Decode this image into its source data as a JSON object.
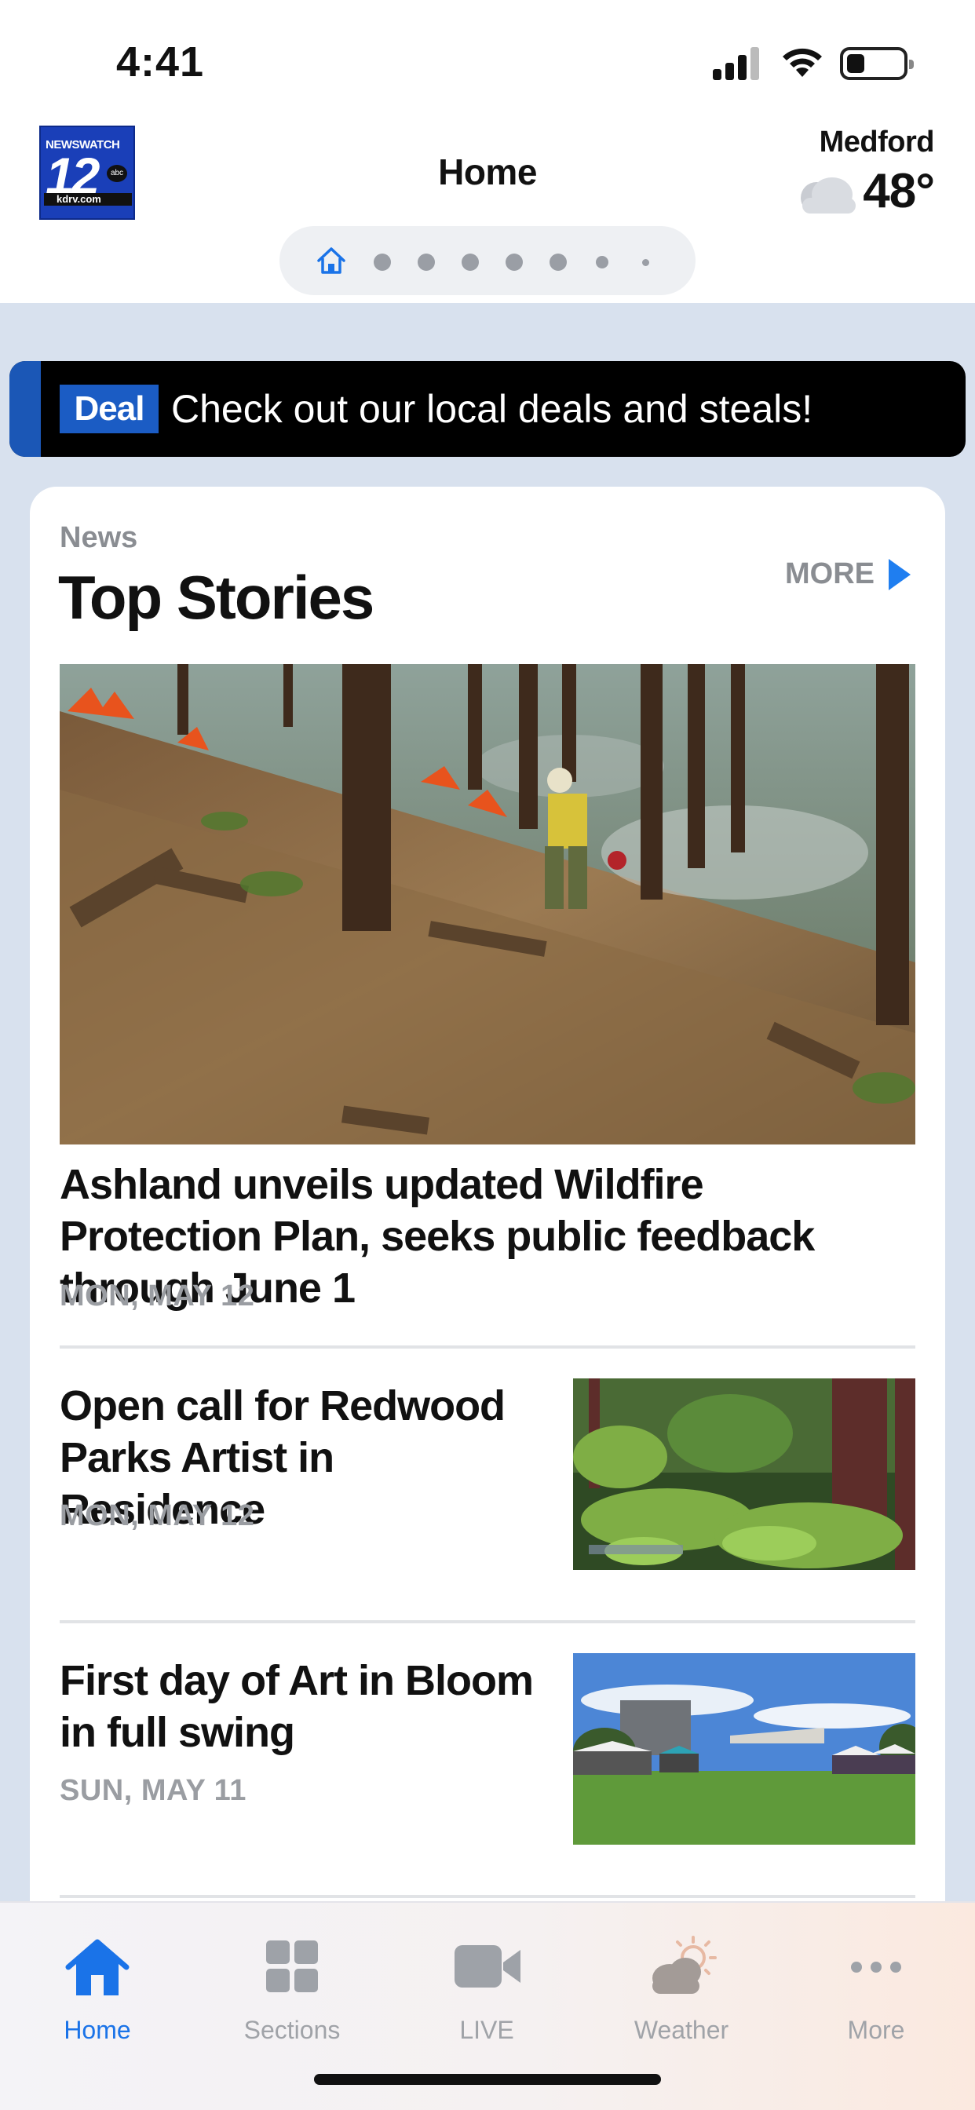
{
  "status_bar": {
    "time": "4:41"
  },
  "header": {
    "logo": {
      "brand": "NEWSWATCH",
      "number": "12",
      "network": "abc",
      "url": "kdrv.com"
    },
    "title": "Home",
    "weather": {
      "city": "Medford",
      "temperature": "48°",
      "icon": "partly-cloudy-icon"
    },
    "pager": {
      "current_index": 0,
      "dot_count": 7
    }
  },
  "deal_banner": {
    "badge": "Deal",
    "message": "Check out our local deals and steals!"
  },
  "top_stories": {
    "kicker": "News",
    "title": "Top Stories",
    "more_label": "MORE",
    "featured": {
      "headline": "Ashland unveils updated Wildfire Protection Plan, seeks public feedback through June 1",
      "date": "MON, MAY 12"
    },
    "stories": [
      {
        "headline": "Open call for Redwood Parks Artist in Residence",
        "date": "MON, MAY 12"
      },
      {
        "headline": "First day of Art in Bloom in full swing",
        "date": "SUN, MAY 11"
      }
    ]
  },
  "tab_bar": {
    "active": "Home",
    "tabs": [
      {
        "label": "Home",
        "icon": "home-icon"
      },
      {
        "label": "Sections",
        "icon": "grid-icon"
      },
      {
        "label": "LIVE",
        "icon": "video-camera-icon"
      },
      {
        "label": "Weather",
        "icon": "partly-cloudy-icon"
      },
      {
        "label": "More",
        "icon": "more-dots-icon"
      }
    ]
  },
  "colors": {
    "accent": "#1a73e8",
    "deal_badge": "#1b5cc4",
    "background": "#d8e1ee"
  }
}
